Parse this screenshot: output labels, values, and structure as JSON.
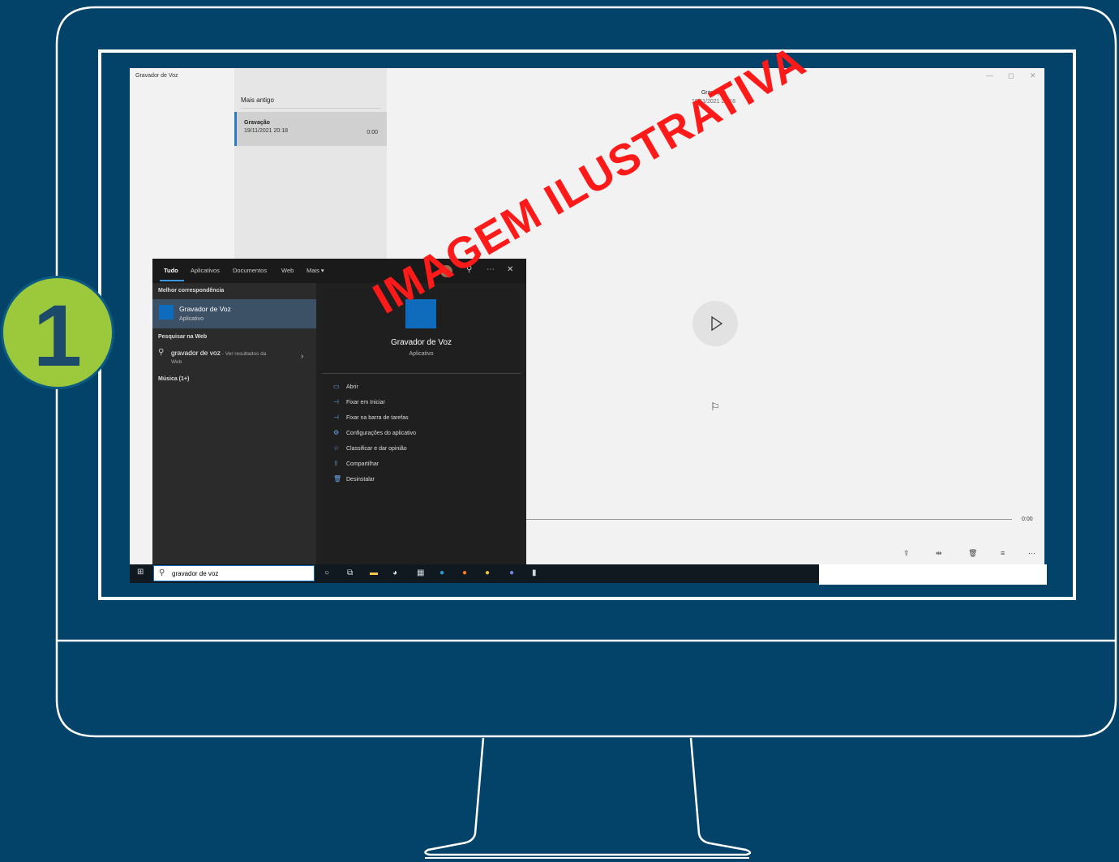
{
  "app": {
    "window_title": "Gravador de Voz",
    "list_header": "Mais antigo",
    "recording": {
      "name": "Gravação",
      "date": "19/11/2021 20:18",
      "duration": "0:00"
    },
    "main_title": "Gravação",
    "main_date": "19/11/2021 20:18",
    "time_end": "0:00",
    "window_controls": [
      "—",
      "◻",
      "✕"
    ],
    "bottom_icons": [
      "share-icon",
      "trim-icon",
      "delete-icon",
      "rename-icon",
      "more-icon"
    ]
  },
  "start_menu": {
    "tabs": [
      "Tudo",
      "Aplicativos",
      "Documentos",
      "Web",
      "Mais ▾"
    ],
    "best_match_header": "Melhor correspondência",
    "best_match": {
      "name": "Gravador de Voz",
      "type": "Aplicativo"
    },
    "web_header": "Pesquisar na Web",
    "web_query": "gravador de voz",
    "web_hint": " - Ver resultados da",
    "web_hint2": "Web",
    "music_header": "Música (1+)",
    "detail": {
      "name": "Gravador de Voz",
      "type": "Aplicativo"
    },
    "actions": [
      {
        "label": "Abrir",
        "icon": "open-icon"
      },
      {
        "label": "Fixar em Iniciar",
        "icon": "pin-icon"
      },
      {
        "label": "Fixar na barra de tarefas",
        "icon": "pin-taskbar-icon"
      },
      {
        "label": "Configurações do aplicativo",
        "icon": "gear-icon"
      },
      {
        "label": "Classificar e dar opinião",
        "icon": "star-icon"
      },
      {
        "label": "Compartilhar",
        "icon": "share-icon"
      },
      {
        "label": "Desinstalar",
        "icon": "trash-icon"
      }
    ]
  },
  "taskbar": {
    "search_text": "gravador de voz"
  },
  "step_badge": "1",
  "watermark": "IMAGEM ILUSTRATIVA",
  "colors": {
    "background": "#03436a",
    "badge": "#9cc93c",
    "watermark": "#ff1a1a",
    "accent": "#0f6cbd"
  }
}
